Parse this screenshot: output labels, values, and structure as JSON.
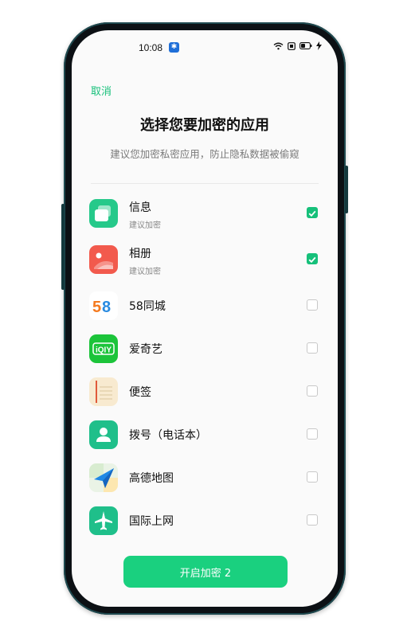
{
  "status_bar": {
    "time": "10:08",
    "notification_icon": "app-notification-icon"
  },
  "header": {
    "cancel_label": "取消",
    "title": "选择您要加密的应用",
    "subtitle": "建议您加密私密应用，防止隐私数据被偷窥"
  },
  "apps": [
    {
      "name": "信息",
      "sub": "建议加密",
      "checked": true,
      "icon": "messages-icon"
    },
    {
      "name": "相册",
      "sub": "建议加密",
      "checked": true,
      "icon": "gallery-icon"
    },
    {
      "name": "58同城",
      "sub": "",
      "checked": false,
      "icon": "58-icon"
    },
    {
      "name": "爱奇艺",
      "sub": "",
      "checked": false,
      "icon": "iqiyi-icon"
    },
    {
      "name": "便签",
      "sub": "",
      "checked": false,
      "icon": "notes-icon"
    },
    {
      "name": "拨号（电话本）",
      "sub": "",
      "checked": false,
      "icon": "phone-contacts-icon"
    },
    {
      "name": "高德地图",
      "sub": "",
      "checked": false,
      "icon": "amap-icon"
    },
    {
      "name": "国际上网",
      "sub": "",
      "checked": false,
      "icon": "airplane-icon"
    }
  ],
  "footer": {
    "button_label": "开启加密 2"
  },
  "colors": {
    "accent": "#16c07a",
    "button": "#1ad07f"
  }
}
